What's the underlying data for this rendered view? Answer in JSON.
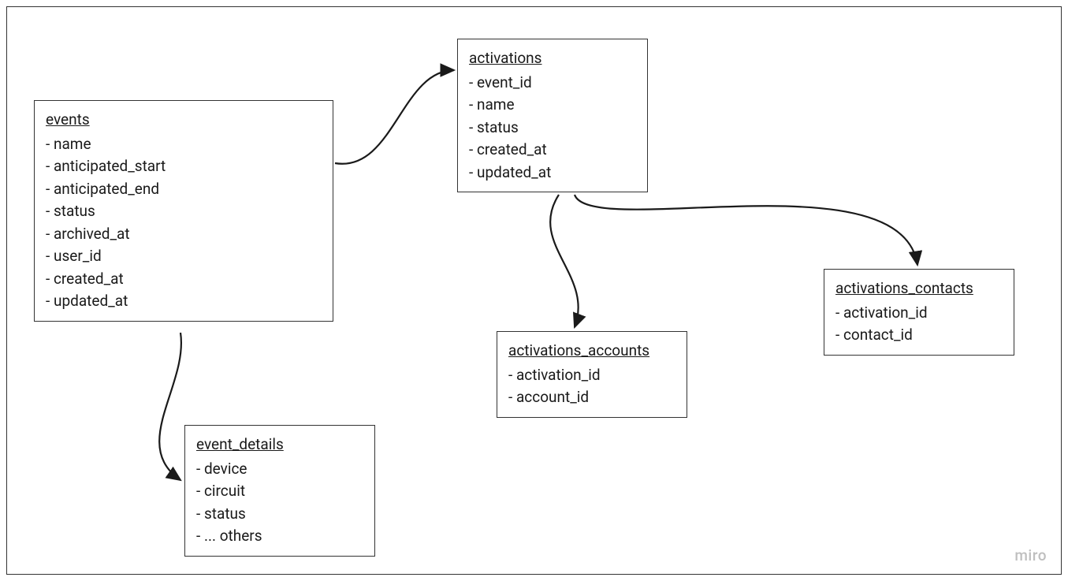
{
  "entities": {
    "events": {
      "title": "events",
      "fields": [
        "- name",
        "- anticipated_start",
        "- anticipated_end",
        "- status",
        "- archived_at",
        "- user_id",
        "- created_at",
        "- updated_at"
      ]
    },
    "event_details": {
      "title": "event_details",
      "fields": [
        "- device",
        "- circuit",
        "- status",
        "- ... others"
      ]
    },
    "activations": {
      "title": "activations",
      "fields": [
        "- event_id",
        "- name",
        "- status",
        "- created_at",
        "- updated_at"
      ]
    },
    "activations_accounts": {
      "title": "activations_accounts",
      "fields": [
        "- activation_id",
        "- account_id"
      ]
    },
    "activations_contacts": {
      "title": "activations_contacts",
      "fields": [
        "- activation_id",
        "- contact_id"
      ]
    }
  },
  "watermark": "miro"
}
